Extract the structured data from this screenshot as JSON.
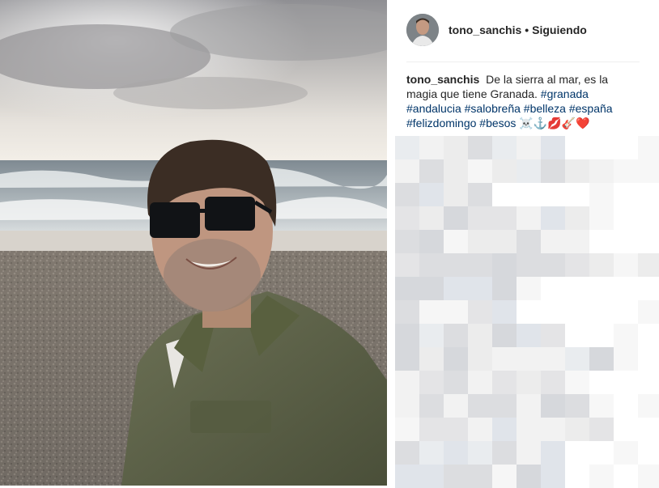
{
  "post": {
    "username": "tono_sanchis",
    "separator": "•",
    "follow_status": "Siguiendo",
    "caption": {
      "username": "tono_sanchis",
      "text": "De la sierra al mar, es la magia que tiene Granada.",
      "hashtags": [
        "#granada",
        "#andalucia",
        "#salobreña",
        "#belleza",
        "#españa",
        "#felizdomingo",
        "#besos"
      ],
      "emojis": "☠️⚓💋🎸❤️"
    }
  },
  "colors": {
    "text": "#262626",
    "hashtag": "#003569",
    "divider": "#efefef"
  },
  "icons": {
    "avatar": "profile-photo",
    "comments": "pixelated-blur"
  }
}
